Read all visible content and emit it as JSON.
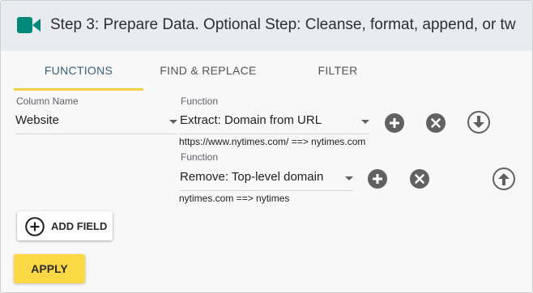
{
  "header": {
    "icon": "video-camera-icon",
    "icon_color": "#00897b",
    "title": "Step 3: Prepare Data. Optional Step: Cleanse, format, append, or tw"
  },
  "tabs": [
    {
      "label": "FUNCTIONS",
      "active": true
    },
    {
      "label": "FIND & REPLACE",
      "active": false
    },
    {
      "label": "FILTER",
      "active": false
    }
  ],
  "colors": {
    "accent": "#f4d046",
    "apply_bg": "#fcd845",
    "action_icon": "#616161"
  },
  "column": {
    "label": "Column Name",
    "value": "Website"
  },
  "functions": [
    {
      "label": "Function",
      "value": "Extract: Domain from URL",
      "example": "https://www.nytimes.com/ ==> nytimes.com",
      "move_icon": "arrow-down-circle-icon"
    },
    {
      "label": "Function",
      "value": "Remove: Top-level domain",
      "example": "nytimes.com ==> nytimes",
      "move_icon": "arrow-up-circle-icon"
    }
  ],
  "actions": {
    "add_field_label": "ADD FIELD",
    "apply_label": "APPLY"
  }
}
